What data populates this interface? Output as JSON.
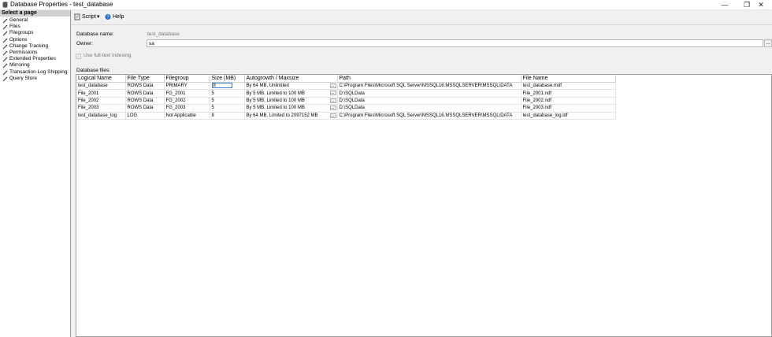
{
  "window": {
    "title": "Database Properties - test_database",
    "controls": {
      "minimize": "—",
      "restore": "❐",
      "close": "✕"
    }
  },
  "left_panel": {
    "header": "Select a page",
    "items": [
      {
        "label": "General"
      },
      {
        "label": "Files"
      },
      {
        "label": "Filegroups"
      },
      {
        "label": "Options"
      },
      {
        "label": "Change Tracking"
      },
      {
        "label": "Permissions"
      },
      {
        "label": "Extended Properties"
      },
      {
        "label": "Mirroring"
      },
      {
        "label": "Transaction Log Shipping"
      },
      {
        "label": "Query Store"
      }
    ]
  },
  "toolbar": {
    "script_label": "Script",
    "dropdown_glyph": "▾",
    "help_label": "Help"
  },
  "form": {
    "db_name_label": "Database name:",
    "db_name_value": "test_database",
    "owner_label": "Owner:",
    "owner_value": "sa",
    "owner_button": "...",
    "fulltext_label": "Use full-text indexing",
    "files_label": "Database files:"
  },
  "table": {
    "columns": [
      "Logical Name",
      "File Type",
      "Filegroup",
      "Size (MB)",
      "Autogrowth / Maxsize",
      "Path",
      "File Name"
    ],
    "ellipsis": "...",
    "rows": [
      [
        "test_database",
        "ROWS Data",
        "PRIMARY",
        "8",
        "By 64 MB, Unlimited",
        "C:\\Program Files\\Microsoft SQL Server\\MSSQL16.MSSQLSERVER\\MSSQL\\DATA",
        "test_database.mdf"
      ],
      [
        "File_2001",
        "ROWS Data",
        "FG_2001",
        "5",
        "By 5 MB, Limited to 100 MB",
        "D:\\SQLData",
        "File_2001.ndf"
      ],
      [
        "File_2002",
        "ROWS Data",
        "FG_2002",
        "5",
        "By 5 MB, Limited to 100 MB",
        "D:\\SQLData",
        "File_2002.ndf"
      ],
      [
        "File_2003",
        "ROWS Data",
        "FG_2003",
        "5",
        "By 5 MB, Limited to 100 MB",
        "D:\\SQLData",
        "File_2003.ndf"
      ],
      [
        "test_database_log",
        "LOG",
        "Not Applicable",
        "8",
        "By 64 MB, Limited to 2097152 MB",
        "C:\\Program Files\\Microsoft SQL Server\\MSSQL16.MSSQLSERVER\\MSSQL\\DATA",
        "test_database_log.ldf"
      ]
    ]
  },
  "colors": {
    "accent": "#3a7fd5",
    "header_gray": "#cfcfcf",
    "panel_bg": "#f0f0f0"
  }
}
